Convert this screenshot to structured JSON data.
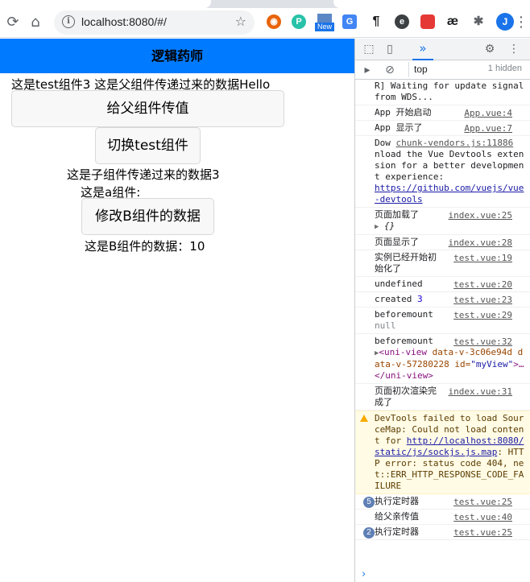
{
  "browser": {
    "url": "localhost:8080/#/",
    "avatar_letter": "J",
    "extensions": [
      "P",
      "New",
      "G",
      "¶",
      "e",
      "æ"
    ]
  },
  "app": {
    "navbar_title": "逻辑药师",
    "line1": "这是test组件3 这是父组件传递过来的数据Hello",
    "btn_pass_to_parent": "给父组件传值",
    "btn_toggle_test": "切换test组件",
    "child_data_text": "这是子组件传递过来的数据3",
    "component_a_label": "这是a组件:",
    "btn_modify_b": "修改B组件的数据",
    "component_b_data": "这是B组件的数据：10"
  },
  "devtools": {
    "context": "top",
    "hidden_count": "1 hidden",
    "messages": {
      "m0": {
        "text": "R] Waiting for update signal from WDS..."
      },
      "m1": {
        "text": "App 开始启动",
        "src": "App.vue:4"
      },
      "m2": {
        "text": "App 显示了",
        "src": "App.vue:7"
      },
      "m3": {
        "pre": "Dow ",
        "src": "chunk-vendors.js:11886",
        "text": "nload the Vue Devtools extension for a better development experience:",
        "link": "https://github.com/vuejs/vue-devtools"
      },
      "m4": {
        "text": "页面加载了",
        "src": "index.vue:25",
        "obj": "{}"
      },
      "m5": {
        "text": "页面显示了",
        "src": "index.vue:28"
      },
      "m6": {
        "text": "实例已经开始初始化了",
        "src": "test.vue:19"
      },
      "m7": {
        "text": "undefined",
        "src": "test.vue:20"
      },
      "m8": {
        "text": "created",
        "num": "3",
        "src": "test.vue:23"
      },
      "m9": {
        "text": "beforemount",
        "src": "test.vue:29",
        "sub": "null"
      },
      "m10": {
        "text": "beforemount",
        "src": "test.vue:32",
        "el_open": "<uni-view",
        "el_attrs": " data-v-3c06e94d data-v-57280228",
        "el_idattr": " id=",
        "el_idval": "\"myView\"",
        "el_close": ">…</uni-view>"
      },
      "m11": {
        "text": "页面初次渲染完成了",
        "src": "index.vue:31"
      },
      "m12": {
        "text": "DevTools failed to load SourceMap: Could not load content for ",
        "link": "http://localhost:8080/static/js/sockjs.js.map",
        "tail": ": HTTP error: status code 404, net::ERR_HTTP_RESPONSE_CODE_FAILURE"
      },
      "m13": {
        "count": "5",
        "text": "执行定时器",
        "src": "test.vue:25"
      },
      "m14": {
        "text": "给父亲传值",
        "src": "test.vue:40"
      },
      "m15": {
        "count": "2",
        "text": "执行定时器",
        "src": "test.vue:25"
      }
    }
  }
}
